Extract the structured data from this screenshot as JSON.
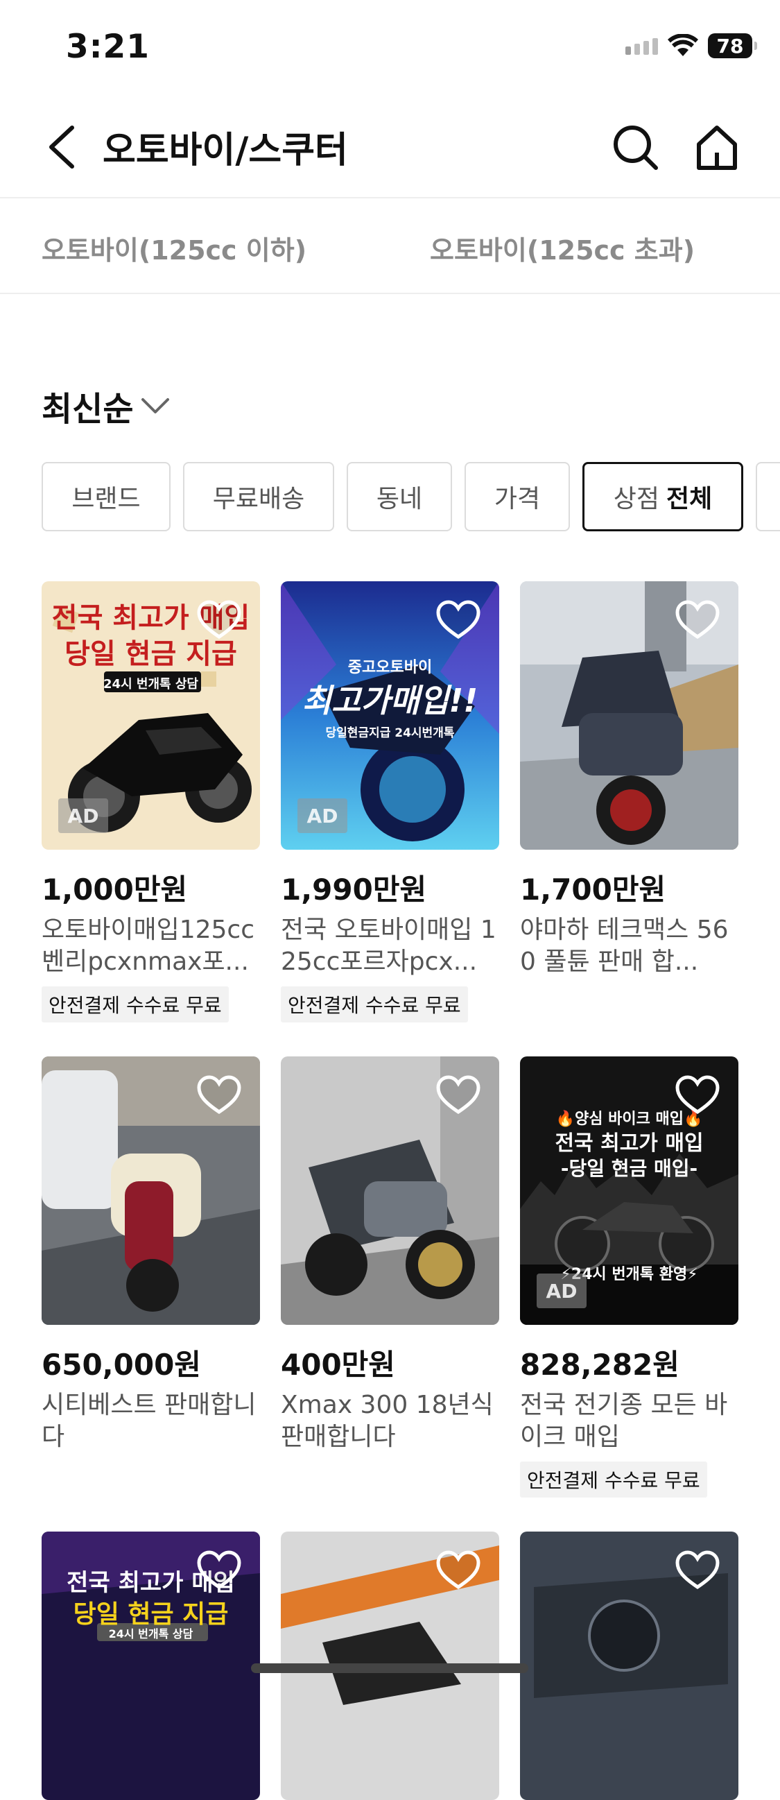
{
  "status_bar": {
    "time": "3:21",
    "battery": "78"
  },
  "header": {
    "title": "오토바이/스쿠터"
  },
  "sub_categories": [
    {
      "label": "오토바이(125cc 이하)"
    },
    {
      "label": "오토바이(125cc 초과)"
    }
  ],
  "sort": {
    "label": "최신순"
  },
  "filters": [
    {
      "label": "브랜드"
    },
    {
      "label": "무료배송"
    },
    {
      "label": "동네"
    },
    {
      "label": "가격"
    },
    {
      "label": "상점",
      "value": "전체"
    }
  ],
  "products": [
    {
      "price": "1,000만원",
      "title": "오토바이매입125cc 벤리pcxnmax포...",
      "safe_badge": "안전결제 수수료 무료",
      "ad": "AD",
      "img_text1": "전국 최고가 매입",
      "img_text2": "당일 현금 지급",
      "img_text3": "24시 번개톡 상담"
    },
    {
      "price": "1,990만원",
      "title": "전국 오토바이매입 125cc포르자pcx...",
      "safe_badge": "안전결제 수수료 무료",
      "ad": "AD",
      "img_text1": "중고오토바이",
      "img_text2": "최고가매입!!",
      "img_text3": "당일현금지급 24시번개톡"
    },
    {
      "price": "1,700만원",
      "title": "야마하 테크맥스 560 풀튠 판매 합..."
    },
    {
      "price": "650,000원",
      "title": "시티베스트 판매합니다"
    },
    {
      "price": "400만원",
      "title": "Xmax 300 18년식 판매합니다"
    },
    {
      "price": "828,282원",
      "title": "전국 전기종 모든 바이크 매입",
      "safe_badge": "안전결제 수수료 무료",
      "ad": "AD",
      "img_text1": "🔥양심 바이크 매입🔥",
      "img_text2": "전국 최고가 매입",
      "img_text3": "-당일 현금 매입-",
      "img_text4": "⚡24시 번개톡 환영⚡"
    },
    {
      "img_text1": "전국 최고가 매입",
      "img_text2": "당일 현금 지급",
      "img_text3": "24시 번개톡 상담"
    },
    {},
    {}
  ],
  "colors": {
    "accent": "#111111",
    "muted_text": "#8a8a8a"
  }
}
